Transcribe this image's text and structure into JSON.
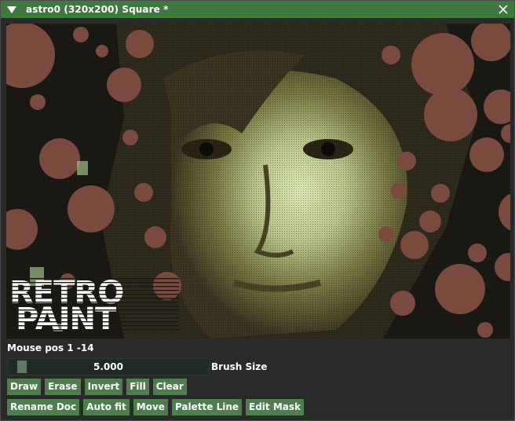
{
  "window": {
    "title": "astro0 (320x200) Square *"
  },
  "icons": {
    "collapse": "triangle-down-icon",
    "close": "close-x-icon"
  },
  "canvas": {
    "logo_line1": "RETRO",
    "logo_line2": "PAINT",
    "palette": {
      "background": "#1b1913",
      "bubble": "#7a4a3e",
      "skin_dark": "#4a4326",
      "skin_mid": "#7a7a44",
      "skin_light": "#b8c48a",
      "highlight": "#dce8b4"
    }
  },
  "status": {
    "mouse_pos": "Mouse pos 1 -14"
  },
  "brush": {
    "value_text": "5.000",
    "label": "Brush Size"
  },
  "toolbar_row1": [
    "Draw",
    "Erase",
    "Invert",
    "Fill",
    "Clear"
  ],
  "toolbar_row2": [
    "Rename Doc",
    "Auto fit",
    "Move",
    "Palette Line",
    "Edit Mask"
  ],
  "colors": {
    "titlebar": "#3d7a3d",
    "button": "#4e7d4e",
    "slider_bg": "#1f2a24",
    "slider_grab": "#5c7a65"
  }
}
